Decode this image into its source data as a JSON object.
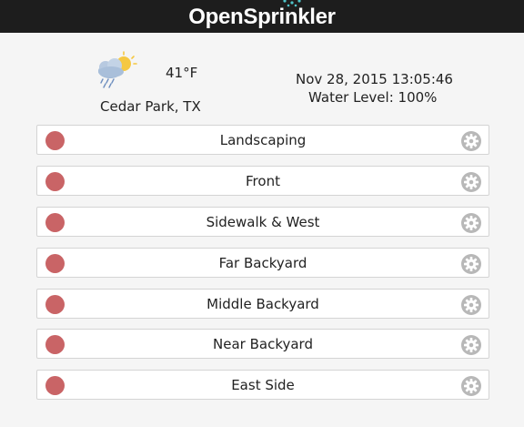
{
  "app": {
    "name": "OpenSprinkler"
  },
  "weather": {
    "icon": "cloud-sun-rain-icon",
    "temperature": "41°F",
    "location": "Cedar Park, TX"
  },
  "status": {
    "datetime": "Nov 28, 2015 13:05:46",
    "water_level": "Water Level: 100%"
  },
  "zones": [
    {
      "name": "Landscaping",
      "state": "off"
    },
    {
      "name": "Front",
      "state": "off"
    },
    {
      "name": "Sidewalk & West",
      "state": "off"
    },
    {
      "name": "Far Backyard",
      "state": "off"
    },
    {
      "name": "Middle Backyard",
      "state": "off"
    },
    {
      "name": "Near Backyard",
      "state": "off"
    },
    {
      "name": "East Side",
      "state": "off"
    }
  ],
  "colors": {
    "header_bg": "#1d1d1d",
    "status_off": "#c96466",
    "accent_drops": "#4fc3c8",
    "gear": "#b8b8b8"
  }
}
